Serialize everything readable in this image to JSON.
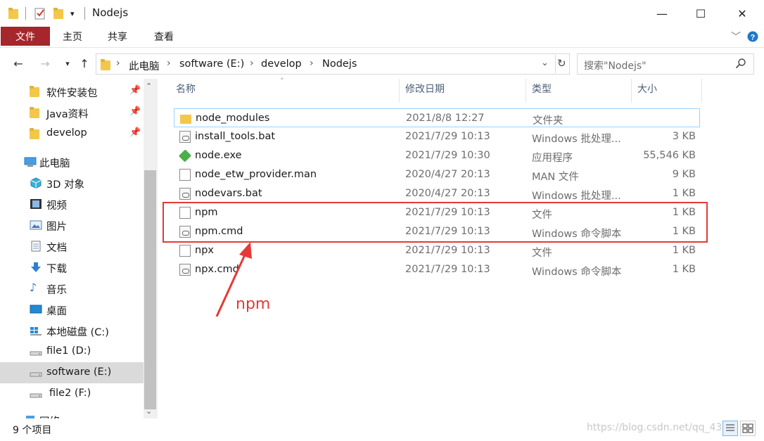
{
  "window": {
    "title": "Nodejs",
    "minimize": "—",
    "maximize": "☐",
    "close": "✕"
  },
  "ribbon": {
    "tabs": [
      "文件",
      "主页",
      "共享",
      "查看"
    ],
    "expand": "﹀",
    "help": "?"
  },
  "address": {
    "crumbs": [
      "此电脑",
      "software (E:)",
      "develop",
      "Nodejs"
    ],
    "search_placeholder": "搜索\"Nodejs\""
  },
  "nav": {
    "quick_access": [
      {
        "label": "软件安装包",
        "pinned": true
      },
      {
        "label": "Java资料",
        "pinned": true
      },
      {
        "label": "develop",
        "pinned": true
      }
    ],
    "this_pc": "此电脑",
    "pc_items": [
      {
        "label": "3D 对象",
        "icon": "3d-objects-icon"
      },
      {
        "label": "视频",
        "icon": "video-icon"
      },
      {
        "label": "图片",
        "icon": "pictures-icon"
      },
      {
        "label": "文档",
        "icon": "documents-icon"
      },
      {
        "label": "下载",
        "icon": "download-icon"
      },
      {
        "label": "音乐",
        "icon": "music-icon"
      },
      {
        "label": "桌面",
        "icon": "desktop-icon"
      },
      {
        "label": "本地磁盘 (C:)",
        "icon": "windows-drive-icon"
      },
      {
        "label": "file1 (D:)",
        "icon": "drive-icon"
      },
      {
        "label": "software (E:)",
        "icon": "drive-icon",
        "selected": true
      },
      {
        "label": "file2 (F:)",
        "icon": "drive-icon"
      }
    ],
    "network": "网络"
  },
  "columns": {
    "name": "名称",
    "date": "修改日期",
    "type": "类型",
    "size": "大小"
  },
  "files": [
    {
      "name": "node_modules",
      "date": "2021/8/8 12:27",
      "type": "文件夹",
      "size": "",
      "icon": "folder"
    },
    {
      "name": "install_tools.bat",
      "date": "2021/7/29 10:13",
      "type": "Windows 批处理...",
      "size": "3 KB",
      "icon": "bat"
    },
    {
      "name": "node.exe",
      "date": "2021/7/29 10:30",
      "type": "应用程序",
      "size": "55,546 KB",
      "icon": "exe"
    },
    {
      "name": "node_etw_provider.man",
      "date": "2020/4/27 20:13",
      "type": "MAN 文件",
      "size": "9 KB",
      "icon": "doc"
    },
    {
      "name": "nodevars.bat",
      "date": "2020/4/27 20:13",
      "type": "Windows 批处理...",
      "size": "1 KB",
      "icon": "bat"
    },
    {
      "name": "npm",
      "date": "2021/7/29 10:13",
      "type": "文件",
      "size": "1 KB",
      "icon": "doc"
    },
    {
      "name": "npm.cmd",
      "date": "2021/7/29 10:13",
      "type": "Windows 命令脚本",
      "size": "1 KB",
      "icon": "bat"
    },
    {
      "name": "npx",
      "date": "2021/7/29 10:13",
      "type": "文件",
      "size": "1 KB",
      "icon": "doc"
    },
    {
      "name": "npx.cmd",
      "date": "2021/7/29 10:13",
      "type": "Windows 命令脚本",
      "size": "1 KB",
      "icon": "bat"
    }
  ],
  "annotation": {
    "label": "npm",
    "color": "#e53935"
  },
  "status": {
    "count": "9 个项目",
    "watermark": "https://blog.csdn.net/qq_43"
  }
}
